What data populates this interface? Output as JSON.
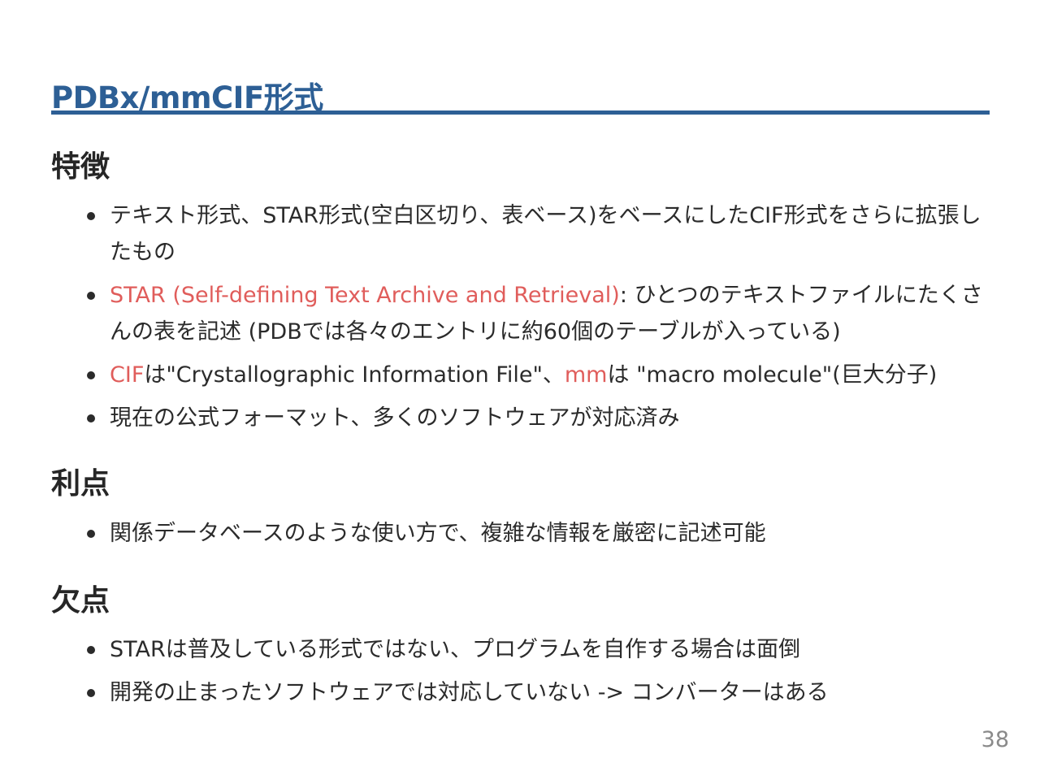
{
  "title": "PDBx/mmCIF形式",
  "colors": {
    "title": "#2d5f95",
    "accent": "#e05d5b",
    "text": "#2b2b2b"
  },
  "sections": [
    {
      "heading": "特徴",
      "items": [
        {
          "lead": "",
          "text": "テキスト形式、STAR形式(空白区切り、表ベース)をベースにしたCIF形式をさらに拡張したもの"
        },
        {
          "lead": "STAR (Self-defining Text Archive and Retrieval)",
          "text": ": ひとつのテキストファイルにたくさんの表を記述 (PDBでは各々のエントリに約60個のテーブルが入っている)"
        },
        {
          "lead": "CIF",
          "text": "は\"Crystallographic Information File\"、",
          "lead2": "mm",
          "text2": "は \"macro molecule\"(巨大分子)"
        },
        {
          "lead": "",
          "text": "現在の公式フォーマット、多くのソフトウェアが対応済み"
        }
      ]
    },
    {
      "heading": "利点",
      "items": [
        {
          "lead": "",
          "text": "関係データベースのような使い方で、複雑な情報を厳密に記述可能"
        }
      ]
    },
    {
      "heading": "欠点",
      "items": [
        {
          "lead": "",
          "text": "STARは普及している形式ではない、プログラムを自作する場合は面倒"
        },
        {
          "lead": "",
          "text": "開発の止まったソフトウェアでは対応していない -> コンバーターはある"
        }
      ]
    }
  ],
  "page_number": "38"
}
